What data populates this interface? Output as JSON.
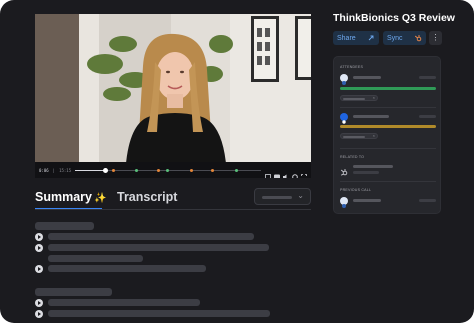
{
  "player": {
    "current_time": "0:06",
    "duration": "15:15",
    "progress_fraction": 0.16
  },
  "tabs": {
    "summary_label": "Summary",
    "summary_icon": "sparkle-icon",
    "transcript_label": "Transcript"
  },
  "sidebar": {
    "meeting_title": "ThinkBionics Q3 Review",
    "share_label": "Share",
    "sync_label": "Sync",
    "more_label": "⋮",
    "attendees_caption": "ATTENDEES",
    "related_caption": "RELATED TO",
    "previous_caption": "PREVIOUS CALL",
    "attendee_1_progress_fraction": 1.0,
    "attendee_2_progress_fraction": 1.0
  },
  "colors": {
    "accent_blue": "#3a86f5",
    "progress_green": "#2f9a57",
    "progress_gold": "#b08a2a",
    "share_button_text": "#6ea8ee"
  }
}
